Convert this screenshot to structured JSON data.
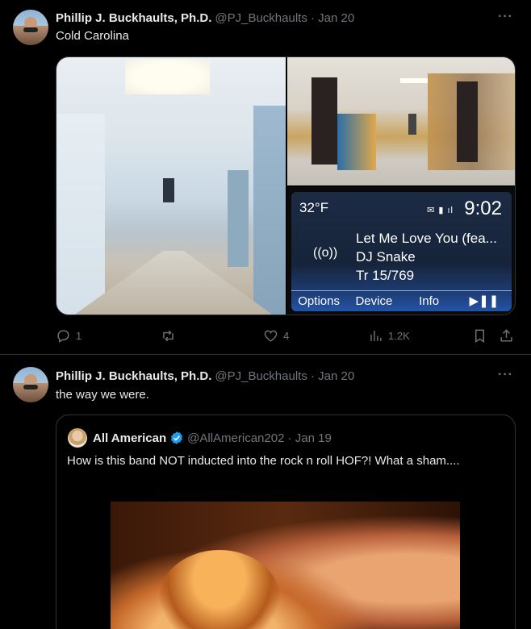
{
  "tweets": [
    {
      "author_name": "Phillip J. Buckhaults, Ph.D.",
      "handle_date": "@PJ_Buckhaults · Jan 20",
      "text": "Cold Carolina",
      "radio": {
        "temp": "32°F",
        "status_icons": "✉ ▮ ıl",
        "time": "9:02",
        "song_line1": "Let Me Love You (fea...",
        "song_line2": "DJ Snake",
        "song_line3": "Tr 15/769",
        "radio_icon": "((o))",
        "buttons": [
          "Options",
          "Device",
          "Info",
          "▶❚❚"
        ]
      },
      "stats": {
        "replies": "1",
        "reposts": "",
        "likes": "4",
        "views": "1.2K"
      }
    },
    {
      "author_name": "Phillip J. Buckhaults, Ph.D.",
      "handle_date": "@PJ_Buckhaults · Jan 20",
      "text": "the way we were.",
      "quote": {
        "author_name": "All American",
        "handle_date": "@AllAmerican202 · Jan 19",
        "text": "How is this band NOT inducted into the rock n roll HOF?!  What a sham...."
      }
    }
  ],
  "more_label": "···",
  "colors": {
    "background": "#000000",
    "text": "#e7e9ea",
    "muted": "#71767b",
    "border": "#2f3336",
    "verified": "#1d9bf0"
  }
}
